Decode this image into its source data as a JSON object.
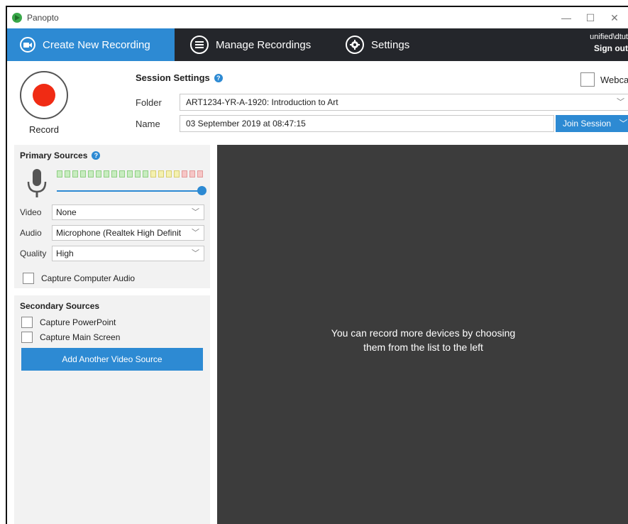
{
  "window": {
    "title": "Panopto",
    "controls": {
      "minimize": "—",
      "maximize": "☐",
      "close": "✕"
    }
  },
  "nav": {
    "tabs": [
      {
        "label": "Create New Recording",
        "icon": "camera-icon",
        "active": true
      },
      {
        "label": "Manage Recordings",
        "icon": "list-icon"
      },
      {
        "label": "Settings",
        "icon": "gear-icon"
      }
    ],
    "user": {
      "name": "unified\\dtut",
      "sign_out": "Sign out"
    }
  },
  "record": {
    "label": "Record"
  },
  "session": {
    "title": "Session Settings",
    "help": "?",
    "folder_label": "Folder",
    "folder_value": "ART1234-YR-A-1920: Introduction to Art",
    "name_label": "Name",
    "name_value": "03 September 2019 at 08:47:15",
    "join_label": "Join Session",
    "webcast_label": "Webcast"
  },
  "primary": {
    "title": "Primary Sources",
    "help": "?",
    "audio_level": 1.0,
    "video_label": "Video",
    "video_value": "None",
    "audio_label": "Audio",
    "audio_value": "Microphone (Realtek High Definit",
    "quality_label": "Quality",
    "quality_value": "High",
    "capture_audio_label": "Capture Computer Audio"
  },
  "secondary": {
    "title": "Secondary Sources",
    "capture_ppt_label": "Capture PowerPoint",
    "capture_screen_label": "Capture Main Screen",
    "add_button_label": "Add Another Video Source"
  },
  "preview": {
    "line1": "You can record more devices by choosing",
    "line2": "them from the list to the left"
  },
  "colors": {
    "accent": "#2d8ad3",
    "navbar": "#24262b",
    "record": "#f02b14",
    "preview_bg": "#3c3c3c"
  }
}
